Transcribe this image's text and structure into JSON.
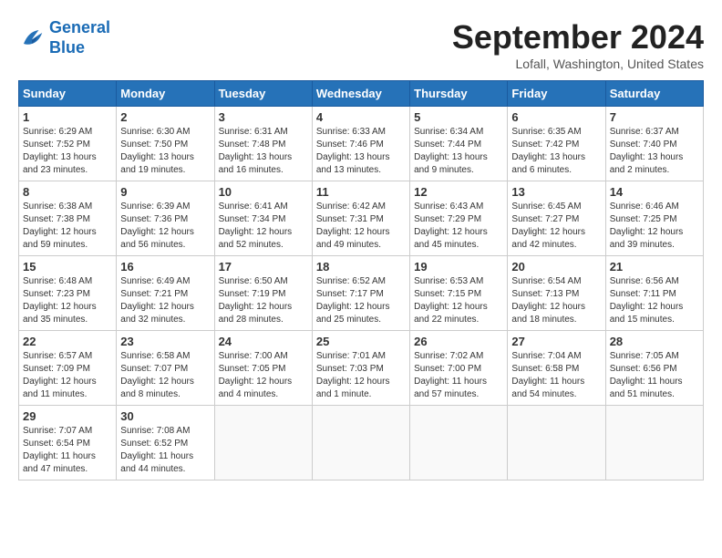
{
  "logo": {
    "line1": "General",
    "line2": "Blue"
  },
  "title": "September 2024",
  "location": "Lofall, Washington, United States",
  "days_header": [
    "Sunday",
    "Monday",
    "Tuesday",
    "Wednesday",
    "Thursday",
    "Friday",
    "Saturday"
  ],
  "weeks": [
    [
      {
        "day": "1",
        "sunrise": "Sunrise: 6:29 AM",
        "sunset": "Sunset: 7:52 PM",
        "daylight": "Daylight: 13 hours and 23 minutes."
      },
      {
        "day": "2",
        "sunrise": "Sunrise: 6:30 AM",
        "sunset": "Sunset: 7:50 PM",
        "daylight": "Daylight: 13 hours and 19 minutes."
      },
      {
        "day": "3",
        "sunrise": "Sunrise: 6:31 AM",
        "sunset": "Sunset: 7:48 PM",
        "daylight": "Daylight: 13 hours and 16 minutes."
      },
      {
        "day": "4",
        "sunrise": "Sunrise: 6:33 AM",
        "sunset": "Sunset: 7:46 PM",
        "daylight": "Daylight: 13 hours and 13 minutes."
      },
      {
        "day": "5",
        "sunrise": "Sunrise: 6:34 AM",
        "sunset": "Sunset: 7:44 PM",
        "daylight": "Daylight: 13 hours and 9 minutes."
      },
      {
        "day": "6",
        "sunrise": "Sunrise: 6:35 AM",
        "sunset": "Sunset: 7:42 PM",
        "daylight": "Daylight: 13 hours and 6 minutes."
      },
      {
        "day": "7",
        "sunrise": "Sunrise: 6:37 AM",
        "sunset": "Sunset: 7:40 PM",
        "daylight": "Daylight: 13 hours and 2 minutes."
      }
    ],
    [
      {
        "day": "8",
        "sunrise": "Sunrise: 6:38 AM",
        "sunset": "Sunset: 7:38 PM",
        "daylight": "Daylight: 12 hours and 59 minutes."
      },
      {
        "day": "9",
        "sunrise": "Sunrise: 6:39 AM",
        "sunset": "Sunset: 7:36 PM",
        "daylight": "Daylight: 12 hours and 56 minutes."
      },
      {
        "day": "10",
        "sunrise": "Sunrise: 6:41 AM",
        "sunset": "Sunset: 7:34 PM",
        "daylight": "Daylight: 12 hours and 52 minutes."
      },
      {
        "day": "11",
        "sunrise": "Sunrise: 6:42 AM",
        "sunset": "Sunset: 7:31 PM",
        "daylight": "Daylight: 12 hours and 49 minutes."
      },
      {
        "day": "12",
        "sunrise": "Sunrise: 6:43 AM",
        "sunset": "Sunset: 7:29 PM",
        "daylight": "Daylight: 12 hours and 45 minutes."
      },
      {
        "day": "13",
        "sunrise": "Sunrise: 6:45 AM",
        "sunset": "Sunset: 7:27 PM",
        "daylight": "Daylight: 12 hours and 42 minutes."
      },
      {
        "day": "14",
        "sunrise": "Sunrise: 6:46 AM",
        "sunset": "Sunset: 7:25 PM",
        "daylight": "Daylight: 12 hours and 39 minutes."
      }
    ],
    [
      {
        "day": "15",
        "sunrise": "Sunrise: 6:48 AM",
        "sunset": "Sunset: 7:23 PM",
        "daylight": "Daylight: 12 hours and 35 minutes."
      },
      {
        "day": "16",
        "sunrise": "Sunrise: 6:49 AM",
        "sunset": "Sunset: 7:21 PM",
        "daylight": "Daylight: 12 hours and 32 minutes."
      },
      {
        "day": "17",
        "sunrise": "Sunrise: 6:50 AM",
        "sunset": "Sunset: 7:19 PM",
        "daylight": "Daylight: 12 hours and 28 minutes."
      },
      {
        "day": "18",
        "sunrise": "Sunrise: 6:52 AM",
        "sunset": "Sunset: 7:17 PM",
        "daylight": "Daylight: 12 hours and 25 minutes."
      },
      {
        "day": "19",
        "sunrise": "Sunrise: 6:53 AM",
        "sunset": "Sunset: 7:15 PM",
        "daylight": "Daylight: 12 hours and 22 minutes."
      },
      {
        "day": "20",
        "sunrise": "Sunrise: 6:54 AM",
        "sunset": "Sunset: 7:13 PM",
        "daylight": "Daylight: 12 hours and 18 minutes."
      },
      {
        "day": "21",
        "sunrise": "Sunrise: 6:56 AM",
        "sunset": "Sunset: 7:11 PM",
        "daylight": "Daylight: 12 hours and 15 minutes."
      }
    ],
    [
      {
        "day": "22",
        "sunrise": "Sunrise: 6:57 AM",
        "sunset": "Sunset: 7:09 PM",
        "daylight": "Daylight: 12 hours and 11 minutes."
      },
      {
        "day": "23",
        "sunrise": "Sunrise: 6:58 AM",
        "sunset": "Sunset: 7:07 PM",
        "daylight": "Daylight: 12 hours and 8 minutes."
      },
      {
        "day": "24",
        "sunrise": "Sunrise: 7:00 AM",
        "sunset": "Sunset: 7:05 PM",
        "daylight": "Daylight: 12 hours and 4 minutes."
      },
      {
        "day": "25",
        "sunrise": "Sunrise: 7:01 AM",
        "sunset": "Sunset: 7:03 PM",
        "daylight": "Daylight: 12 hours and 1 minute."
      },
      {
        "day": "26",
        "sunrise": "Sunrise: 7:02 AM",
        "sunset": "Sunset: 7:00 PM",
        "daylight": "Daylight: 11 hours and 57 minutes."
      },
      {
        "day": "27",
        "sunrise": "Sunrise: 7:04 AM",
        "sunset": "Sunset: 6:58 PM",
        "daylight": "Daylight: 11 hours and 54 minutes."
      },
      {
        "day": "28",
        "sunrise": "Sunrise: 7:05 AM",
        "sunset": "Sunset: 6:56 PM",
        "daylight": "Daylight: 11 hours and 51 minutes."
      }
    ],
    [
      {
        "day": "29",
        "sunrise": "Sunrise: 7:07 AM",
        "sunset": "Sunset: 6:54 PM",
        "daylight": "Daylight: 11 hours and 47 minutes."
      },
      {
        "day": "30",
        "sunrise": "Sunrise: 7:08 AM",
        "sunset": "Sunset: 6:52 PM",
        "daylight": "Daylight: 11 hours and 44 minutes."
      },
      null,
      null,
      null,
      null,
      null
    ]
  ]
}
